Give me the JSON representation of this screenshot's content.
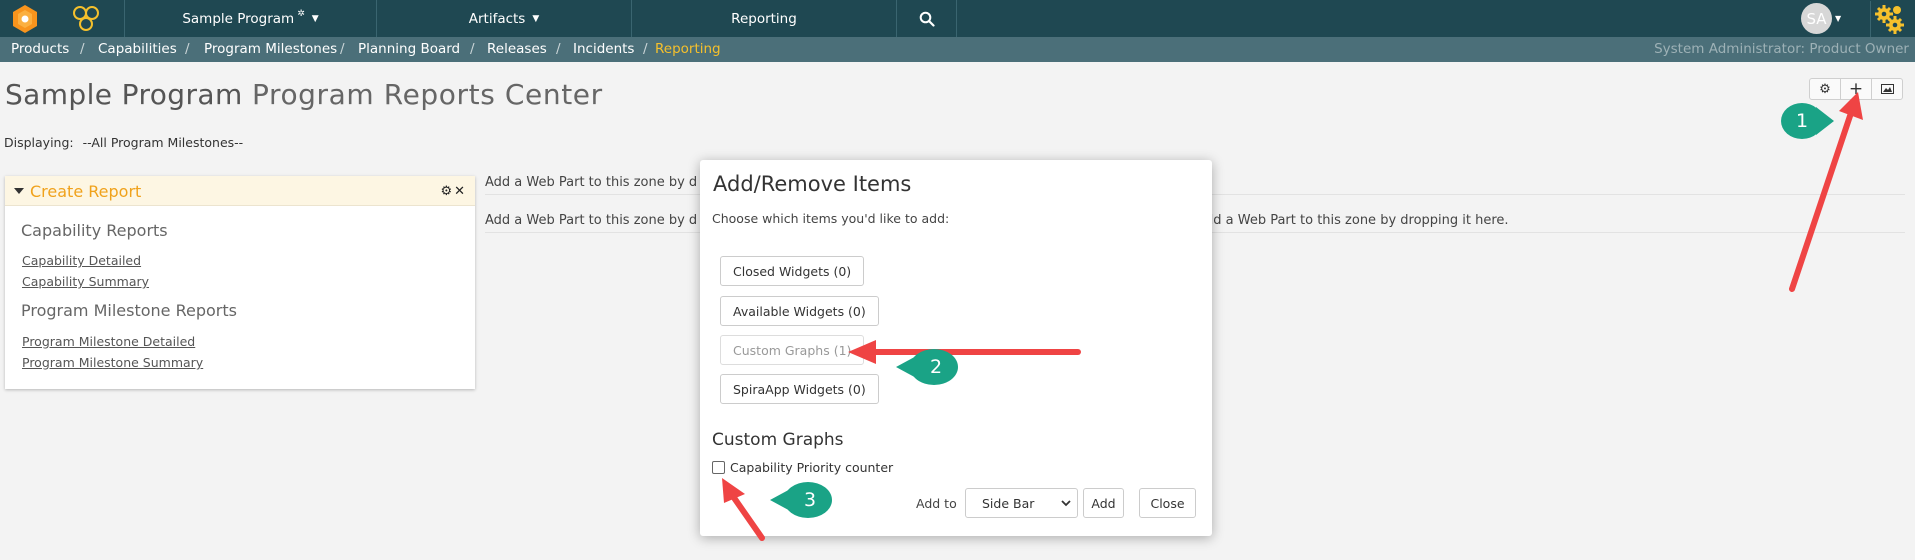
{
  "topbar": {
    "program": "Sample Program",
    "artifacts": "Artifacts",
    "reporting": "Reporting",
    "avatar": "SA"
  },
  "breadcrumb": {
    "items": [
      "Products",
      "Capabilities",
      "Program Milestones",
      "Planning Board",
      "Releases",
      "Incidents"
    ],
    "current": "Reporting",
    "separator": "/",
    "user": "System Administrator: Product Owner"
  },
  "page": {
    "title_prefix": "Sample Program",
    "title_main": "Program Reports Center",
    "displaying_label": "Displaying:",
    "displaying_value": "--All Program Milestones--"
  },
  "create_report": {
    "title": "Create Report",
    "capability_heading": "Capability Reports",
    "capability_links": [
      "Capability Detailed",
      "Capability Summary"
    ],
    "milestone_heading": "Program Milestone Reports",
    "milestone_links": [
      "Program Milestone Detailed",
      "Program Milestone Summary"
    ]
  },
  "zones": {
    "row1_text": "Add a Web Part to this zone by d",
    "row2_text": "Add a Web Part to this zone by d",
    "row2_right_text": "dd a Web Part to this zone by dropping it here."
  },
  "modal": {
    "title": "Add/Remove Items",
    "subtitle": "Choose which items you'd like to add:",
    "buttons": [
      "Closed Widgets (0)",
      "Available Widgets (0)",
      "Custom Graphs (1)",
      "SpiraApp Widgets (0)"
    ],
    "section_title": "Custom Graphs",
    "checkbox_label": "Capability Priority counter",
    "add_to_label": "Add to",
    "add_to_value": "Side Bar",
    "add_button": "Add",
    "close_button": "Close"
  },
  "callouts": [
    "1",
    "2",
    "3"
  ],
  "colors": {
    "topbar": "#1f4852",
    "subbar": "#4b6f79",
    "accent": "#f5c02c",
    "report_title": "#f0a21c",
    "callout": "#1aa386",
    "arrow": "#ef4444"
  },
  "icons": [
    "logo-icon",
    "honeycomb-icon",
    "search-icon",
    "gear-icon",
    "plus-icon",
    "image-icon",
    "close-icon",
    "chevron-down-icon",
    "gears-icon"
  ]
}
